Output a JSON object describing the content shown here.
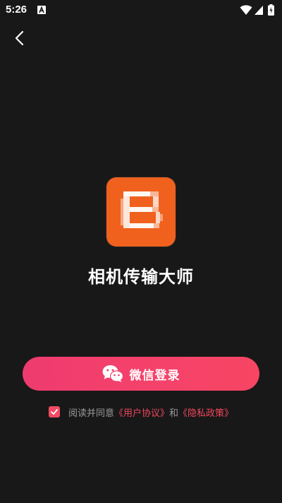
{
  "status_bar": {
    "time": "5:26",
    "icons": [
      "accessibility-a-icon",
      "wifi-icon",
      "cellular-signal-icon",
      "battery-charging-icon"
    ]
  },
  "nav": {
    "back_icon": "chevron-left-icon"
  },
  "app": {
    "logo_icon": "app-logo-icon",
    "name": "相机传输大师"
  },
  "login": {
    "wechat_label": "微信登录",
    "wechat_icon": "wechat-icon"
  },
  "agreement": {
    "checked": true,
    "prefix": "阅读并同意",
    "user_agreement": "《用户协议》",
    "and": "和",
    "privacy_policy": "《隐私政策》"
  },
  "colors": {
    "background": "#181818",
    "logo_orange": "#f0611e",
    "button_gradient_start": "#ee3b6f",
    "button_gradient_end": "#f74563",
    "link_red": "#f0475d",
    "muted_text": "#9a9a9a"
  }
}
